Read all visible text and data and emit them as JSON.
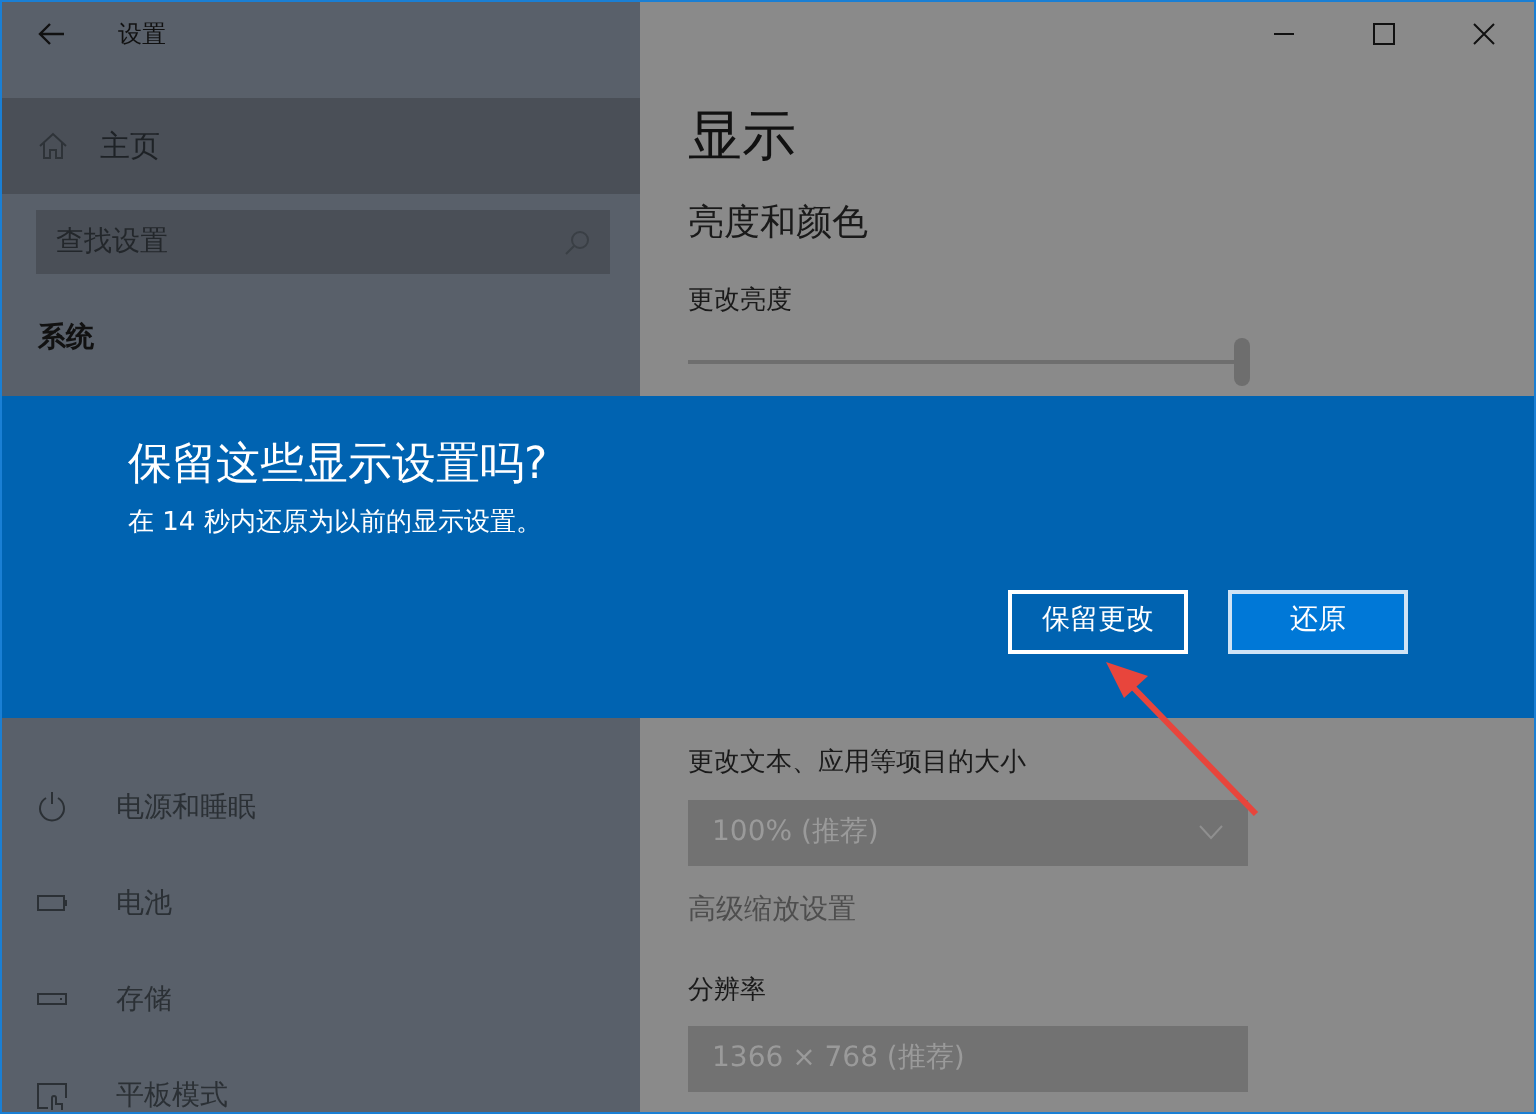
{
  "window": {
    "title": "设置"
  },
  "sidebar": {
    "home": "主页",
    "search": {
      "placeholder": "查找设置"
    },
    "section": "系统",
    "items": [
      {
        "label": "电源和睡眠",
        "kind": "power"
      },
      {
        "label": "电池",
        "kind": "battery"
      },
      {
        "label": "存储",
        "kind": "storage"
      },
      {
        "label": "平板模式",
        "kind": "tablet"
      }
    ]
  },
  "content": {
    "heading": "显示",
    "subheading": "亮度和颜色",
    "brightness": {
      "label": "更改亮度",
      "level": 0.99
    },
    "scale": {
      "label": "更改文本、应用等项目的大小",
      "value": "100% (推荐)"
    },
    "advanced_link": "高级缩放设置",
    "resolution": {
      "label": "分辨率",
      "value": "1366 × 768 (推荐)"
    }
  },
  "dialog": {
    "title": "保留这些显示设置吗?",
    "message": "在 14 秒内还原为以前的显示设置。",
    "buttons": [
      {
        "label": "保留更改",
        "focused": true
      },
      {
        "label": "还原",
        "focused": false
      }
    ]
  }
}
